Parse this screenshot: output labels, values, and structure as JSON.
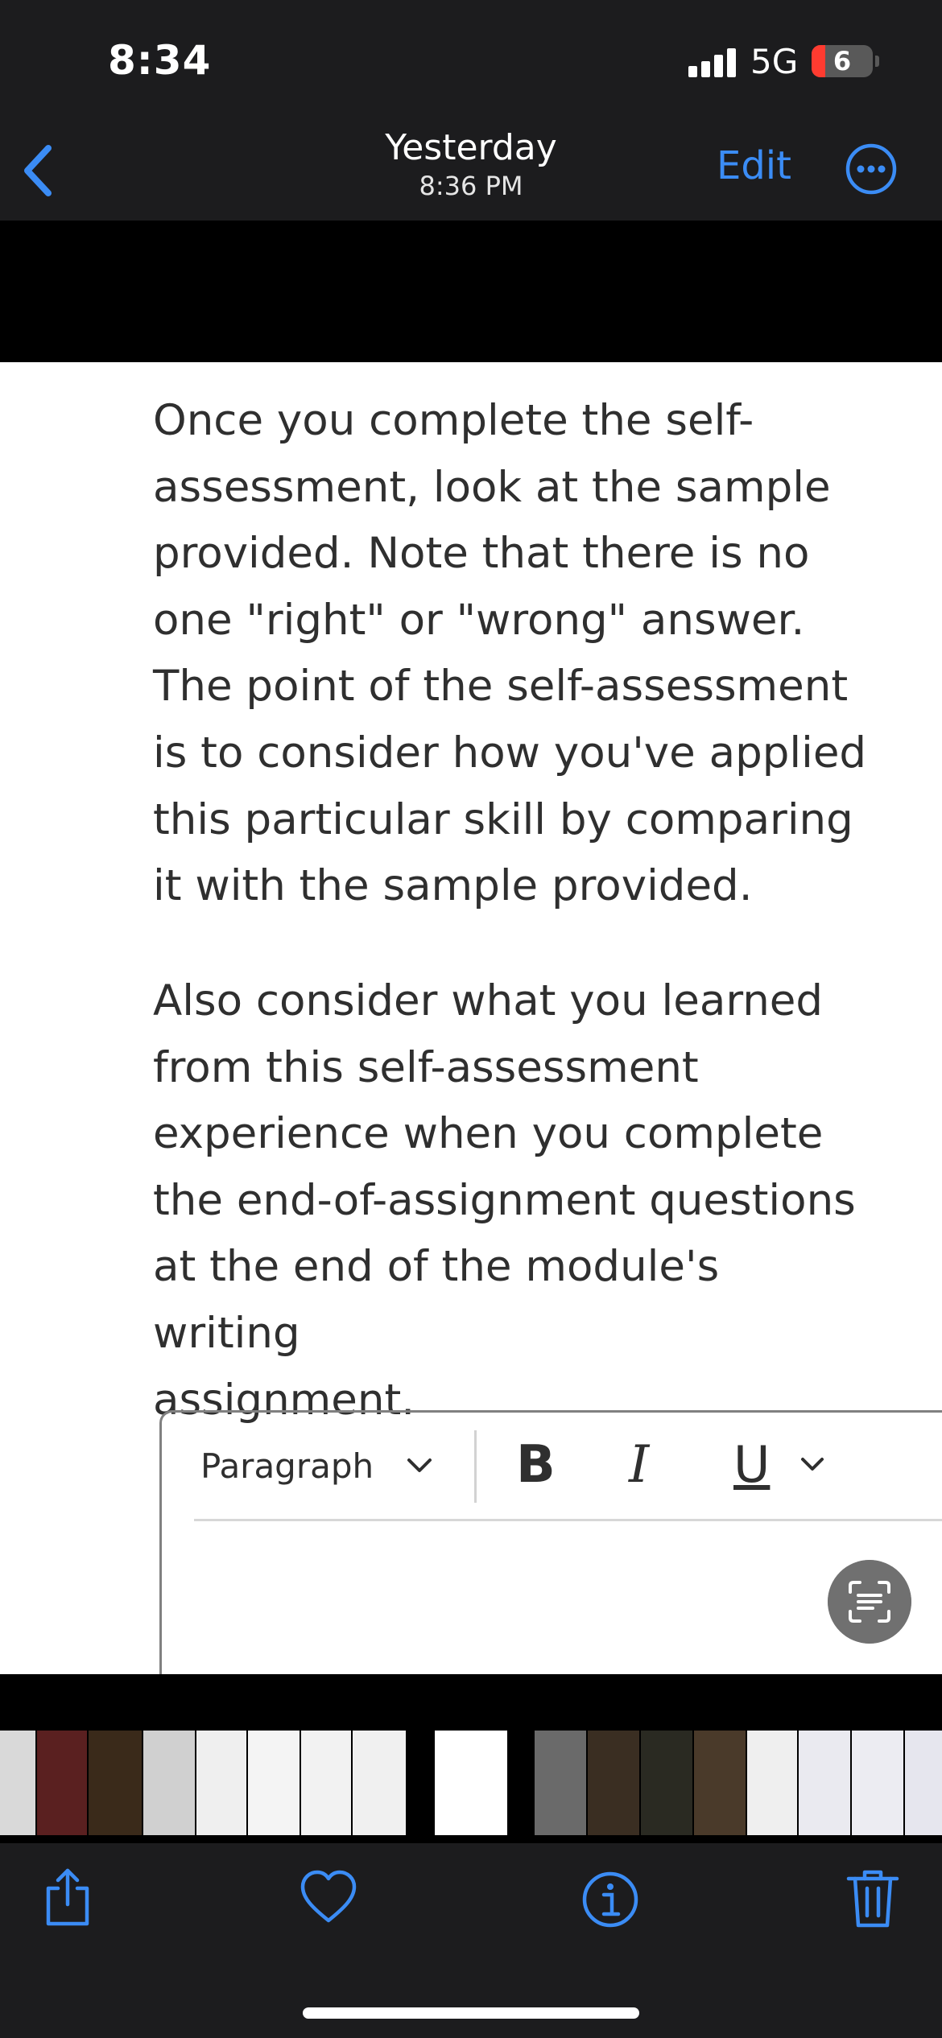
{
  "status": {
    "time": "8:34",
    "network": "5G",
    "battery": "6"
  },
  "nav": {
    "title": "Yesterday",
    "subtitle": "8:36 PM",
    "edit_label": "Edit"
  },
  "note": {
    "para1_lines": [
      "Once you complete the self-",
      "assessment, look at the sample",
      "provided. Note that there is no",
      "one \"right\" or \"wrong\" answer.",
      "The point of the self-assessment",
      "is to consider how you've applied",
      "this particular skill by comparing",
      "it with the sample provided."
    ],
    "para2_lines": [
      "Also consider what you learned",
      "from this self-assessment",
      "experience when you complete",
      "the end-of-assignment questions",
      "at the end of the module's writing",
      "assignment."
    ]
  },
  "editor": {
    "format_label": "Paragraph",
    "bold_label": "B",
    "italic_label": "I",
    "underline_label": "U"
  },
  "thumbnails": [
    {
      "color": "#d9d9d9"
    },
    {
      "color": "#5a2020"
    },
    {
      "color": "#3a2a1a"
    },
    {
      "color": "#d0d0d0"
    },
    {
      "color": "#efefef"
    },
    {
      "color": "#f4f4f4"
    },
    {
      "color": "#f2f2f2"
    },
    {
      "color": "#f0f0f0"
    },
    {
      "color": "#ffffff"
    },
    {
      "color": "#6a6a6a"
    },
    {
      "color": "#3a2e22"
    },
    {
      "color": "#2a2a22"
    },
    {
      "color": "#4a3a2a"
    },
    {
      "color": "#efefef"
    },
    {
      "color": "#eaeaf0"
    },
    {
      "color": "#ececf2"
    },
    {
      "color": "#e6e6ee"
    }
  ],
  "colors": {
    "accent": "#3b8cf5",
    "bar_bg": "#1c1c1e",
    "text": "#2f2f2f"
  }
}
